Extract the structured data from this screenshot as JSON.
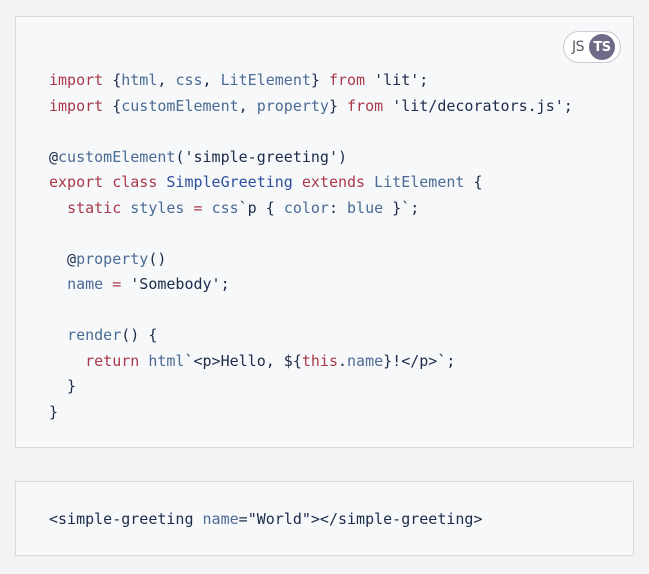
{
  "language_toggle": {
    "js_label": "JS",
    "ts_label": "TS",
    "selected": "TS"
  },
  "code_example": {
    "lines": [
      [
        {
          "t": "import",
          "c": "keyword"
        },
        {
          "t": " {",
          "c": "default"
        },
        {
          "t": "html",
          "c": "builtin"
        },
        {
          "t": ", ",
          "c": "default"
        },
        {
          "t": "css",
          "c": "builtin"
        },
        {
          "t": ", ",
          "c": "default"
        },
        {
          "t": "LitElement",
          "c": "builtin"
        },
        {
          "t": "} ",
          "c": "default"
        },
        {
          "t": "from",
          "c": "keyword"
        },
        {
          "t": " ",
          "c": "default"
        },
        {
          "t": "'lit'",
          "c": "string"
        },
        {
          "t": ";",
          "c": "default"
        }
      ],
      [
        {
          "t": "import",
          "c": "keyword"
        },
        {
          "t": " {",
          "c": "default"
        },
        {
          "t": "customElement",
          "c": "builtin"
        },
        {
          "t": ", ",
          "c": "default"
        },
        {
          "t": "property",
          "c": "builtin"
        },
        {
          "t": "} ",
          "c": "default"
        },
        {
          "t": "from",
          "c": "keyword"
        },
        {
          "t": " ",
          "c": "default"
        },
        {
          "t": "'lit/decorators.js'",
          "c": "string"
        },
        {
          "t": ";",
          "c": "default"
        }
      ],
      [],
      [
        {
          "t": "@",
          "c": "meta"
        },
        {
          "t": "customElement",
          "c": "builtin"
        },
        {
          "t": "(",
          "c": "default"
        },
        {
          "t": "'simple-greeting'",
          "c": "string"
        },
        {
          "t": ")",
          "c": "default"
        }
      ],
      [
        {
          "t": "export",
          "c": "keyword"
        },
        {
          "t": " ",
          "c": "default"
        },
        {
          "t": "class",
          "c": "keyword"
        },
        {
          "t": " ",
          "c": "default"
        },
        {
          "t": "SimpleGreeting",
          "c": "def"
        },
        {
          "t": " ",
          "c": "default"
        },
        {
          "t": "extends",
          "c": "keyword"
        },
        {
          "t": " ",
          "c": "default"
        },
        {
          "t": "LitElement",
          "c": "builtin"
        },
        {
          "t": " {",
          "c": "default"
        }
      ],
      [
        {
          "t": "  ",
          "c": "default"
        },
        {
          "t": "static",
          "c": "keyword"
        },
        {
          "t": " ",
          "c": "default"
        },
        {
          "t": "styles",
          "c": "builtin"
        },
        {
          "t": " ",
          "c": "default"
        },
        {
          "t": "=",
          "c": "keyword"
        },
        {
          "t": " ",
          "c": "default"
        },
        {
          "t": "css",
          "c": "builtin"
        },
        {
          "t": "`p { ",
          "c": "default"
        },
        {
          "t": "color",
          "c": "builtin"
        },
        {
          "t": ": ",
          "c": "default"
        },
        {
          "t": "blue",
          "c": "builtin"
        },
        {
          "t": " }`;",
          "c": "default"
        }
      ],
      [],
      [
        {
          "t": "  @",
          "c": "meta"
        },
        {
          "t": "property",
          "c": "builtin"
        },
        {
          "t": "()",
          "c": "default"
        }
      ],
      [
        {
          "t": "  ",
          "c": "default"
        },
        {
          "t": "name",
          "c": "builtin"
        },
        {
          "t": " ",
          "c": "default"
        },
        {
          "t": "=",
          "c": "keyword"
        },
        {
          "t": " ",
          "c": "default"
        },
        {
          "t": "'Somebody'",
          "c": "string"
        },
        {
          "t": ";",
          "c": "default"
        }
      ],
      [],
      [
        {
          "t": "  ",
          "c": "default"
        },
        {
          "t": "render",
          "c": "builtin"
        },
        {
          "t": "() {",
          "c": "default"
        }
      ],
      [
        {
          "t": "    ",
          "c": "default"
        },
        {
          "t": "return",
          "c": "keyword"
        },
        {
          "t": " ",
          "c": "default"
        },
        {
          "t": "html",
          "c": "builtin"
        },
        {
          "t": "`<p>Hello, ${",
          "c": "default"
        },
        {
          "t": "this",
          "c": "keyword"
        },
        {
          "t": ".",
          "c": "default"
        },
        {
          "t": "name",
          "c": "builtin"
        },
        {
          "t": "}!</p>`;",
          "c": "default"
        }
      ],
      [
        {
          "t": "  }",
          "c": "default"
        }
      ],
      [
        {
          "t": "}",
          "c": "default"
        }
      ]
    ]
  },
  "usage_example": {
    "lines": [
      [
        {
          "t": "<simple-greeting ",
          "c": "default"
        },
        {
          "t": "name",
          "c": "attr"
        },
        {
          "t": "=",
          "c": "default"
        },
        {
          "t": "\"World\"",
          "c": "string"
        },
        {
          "t": "></simple-greeting>",
          "c": "default"
        }
      ]
    ]
  },
  "colors": {
    "keyword": "#a9394a",
    "builtin": "#4c6b94",
    "text": "#1c2b4a",
    "panel_background": "#f6f8fa",
    "page_background": "#f2f3f5",
    "ts_badge": "#6f6a86"
  }
}
